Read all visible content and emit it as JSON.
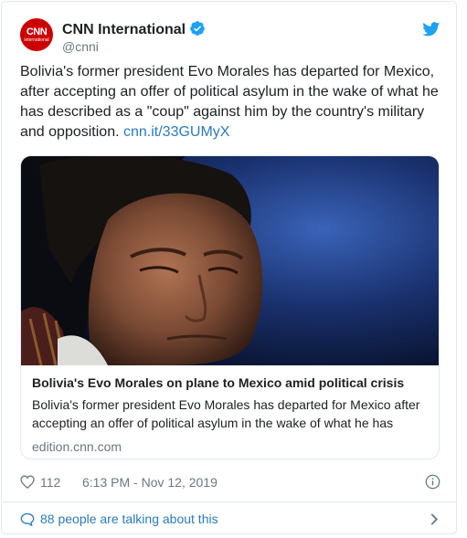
{
  "author": {
    "display_name": "CNN International",
    "handle": "@cnni",
    "avatar_logo": "CNN",
    "avatar_logo_sub": "international",
    "verified": true
  },
  "tweet": {
    "text": "Bolivia's former president Evo Morales has departed for Mexico, after accepting an offer of political asylum in the wake of what he has described as a \"coup\" against him by the country's military and opposition. ",
    "link": "cnn.it/33GUMyX"
  },
  "card": {
    "title": "Bolivia's Evo Morales on plane to Mexico amid political crisis",
    "description": "Bolivia's former president Evo Morales has departed for Mexico after accepting an offer of political asylum in the wake of what he has",
    "domain": "edition.cnn.com"
  },
  "meta": {
    "likes": "112",
    "timestamp": "6:13 PM - Nov 12, 2019"
  },
  "footer": {
    "talking": "88 people are talking about this"
  },
  "icons": {
    "verified": "verified-badge-icon",
    "brand": "twitter-bird-icon",
    "like": "heart-icon",
    "info": "info-icon",
    "reply": "speech-bubble-icon",
    "more": "chevron-right-icon"
  },
  "colors": {
    "avatar": "#cc0000",
    "link": "#2b7bb9",
    "twitter_blue": "#1da1f2",
    "muted": "#697882",
    "border": "#e1e8ed"
  }
}
